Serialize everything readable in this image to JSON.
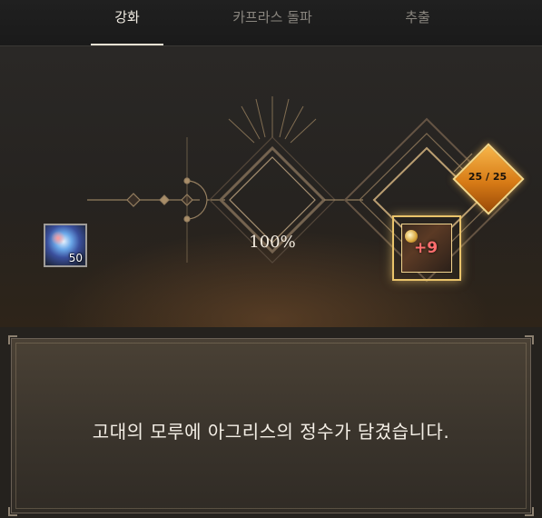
{
  "tabs": [
    {
      "label": "강화",
      "active": true
    },
    {
      "label": "카프라스 돌파",
      "active": false
    },
    {
      "label": "추출",
      "active": false
    }
  ],
  "enhance": {
    "material_count": "50",
    "success_rate": "100%",
    "item_upgrade_level": "+9",
    "counter": "25 / 25"
  },
  "message": "고대의 모루에 아그리스의 정수가 담겼습니다.",
  "colors": {
    "accent_gold": "#e9c36a",
    "counter_orange": "#e08a22",
    "upgrade_red": "#ff6e6e"
  }
}
